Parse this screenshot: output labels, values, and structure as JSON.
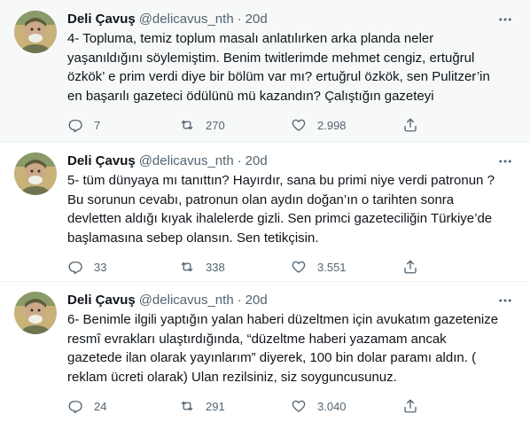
{
  "tweets": [
    {
      "author_name": "Deli Çavuş",
      "author_handle": "@delicavus_nth",
      "separator": "·",
      "time": "20d",
      "text": "4- Topluma, temiz toplum masalı anlatılırken arka planda neler yaşanıldığını söylemiştim. Benim twitlerimde mehmet cengiz, ertuğrul özkök’ e prim verdi diye bir bölüm var mı? ertuğrul özkök, sen Pulitzer’in en başarılı gazeteci ödülünü mü kazandın? Çalıştığın gazeteyi",
      "replies": "7",
      "retweets": "270",
      "likes": "2.998"
    },
    {
      "author_name": "Deli Çavuş",
      "author_handle": "@delicavus_nth",
      "separator": "·",
      "time": "20d",
      "text": "5- tüm dünyaya mı tanıttın? Hayırdır, sana bu primi niye verdi patronun ? Bu sorunun cevabı, patronun olan aydın doğan’ın o tarihten sonra devletten aldığı kıyak ihalelerde gizli. Sen primci gazeteciliğin Türkiye’de başlamasına sebep olansın. Sen tetikçisin.",
      "replies": "33",
      "retweets": "338",
      "likes": "3.551"
    },
    {
      "author_name": "Deli Çavuş",
      "author_handle": "@delicavus_nth",
      "separator": "·",
      "time": "20d",
      "text": "6- Benimle ilgili yaptığın yalan haberi düzeltmen için avukatım gazetenize resmî evrakları ulaştırdığında, “düzeltme haberi yazamam ancak gazetede ilan olarak yayınlarım” diyerek, 100 bin dolar paramı aldın. ( reklam ücreti olarak) Ulan rezilsiniz, siz soyguncusunuz.",
      "replies": "24",
      "retweets": "291",
      "likes": "3.040"
    }
  ],
  "icons": {
    "reply": "reply-icon",
    "retweet": "retweet-icon",
    "like": "heart-icon",
    "share": "share-icon",
    "more": "more-dots-icon"
  },
  "colors": {
    "text_primary": "#0f1419",
    "text_secondary": "#536471",
    "highlight_bg": "#f7f9f9"
  }
}
